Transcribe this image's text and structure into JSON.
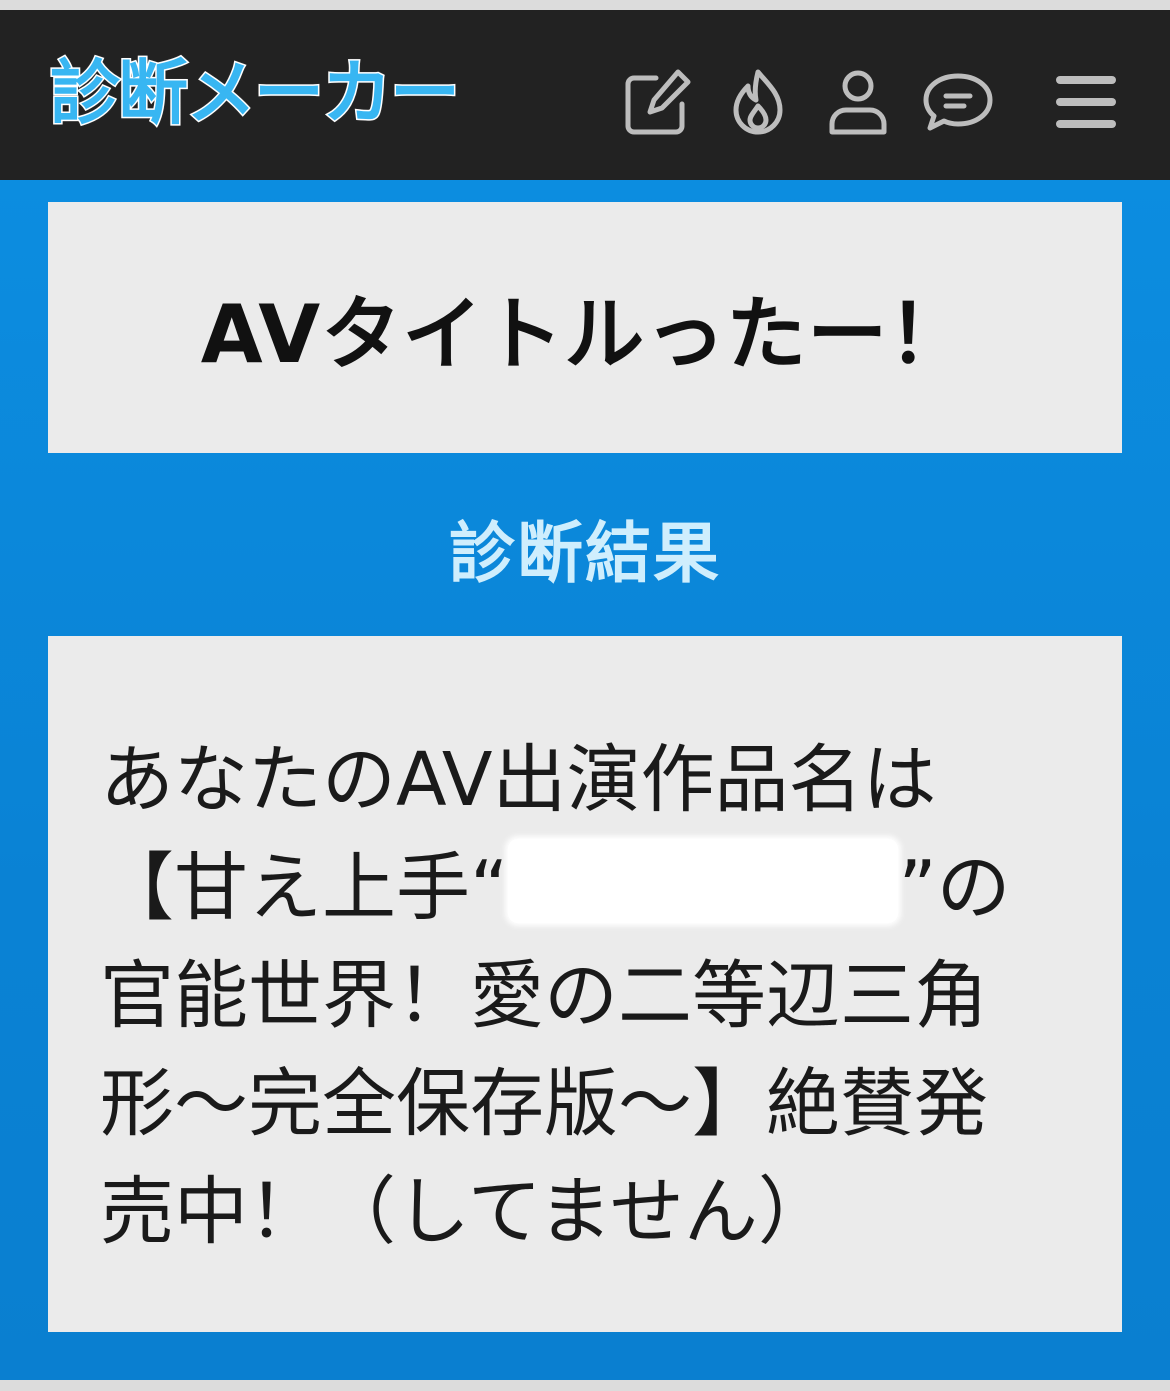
{
  "app": {
    "logo_text": "診断メーカー"
  },
  "header": {
    "icons": [
      "edit-icon",
      "flame-icon",
      "user-icon",
      "chat-icon",
      "menu-icon"
    ]
  },
  "diagnosis": {
    "title": "AVタイトルったー！",
    "result_heading": "診断結果",
    "result_lines": [
      "あなたのAV出演作品名は",
      "【甘え上手“",
      "”の",
      "官能世界！愛の二等辺三角",
      "形～完全保存版～】絶賛発",
      "売中！（してません）"
    ]
  },
  "colors": {
    "header_bg": "#222222",
    "main_bg": "#0b86d8",
    "card_bg": "#ebebeb",
    "logo": "#38b6f2",
    "heading": "#cfeefd",
    "icon_gray": "#bdbdbd"
  }
}
